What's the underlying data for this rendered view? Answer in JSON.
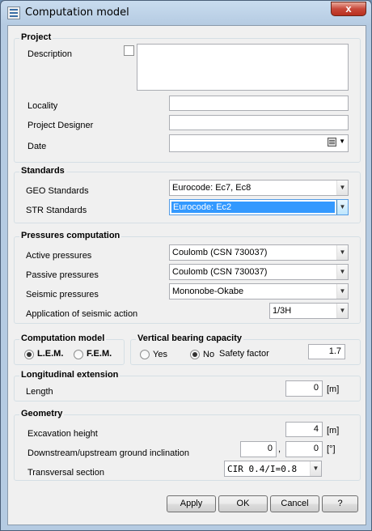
{
  "window": {
    "title": "Computation model",
    "close_glyph": "x"
  },
  "project": {
    "title": "Project",
    "description_label": "Description",
    "description_value": "",
    "locality_label": "Locality",
    "locality_value": "",
    "designer_label": "Project Designer",
    "designer_value": "",
    "date_label": "Date",
    "date_value": ""
  },
  "standards": {
    "title": "Standards",
    "geo_label": "GEO Standards",
    "geo_value": "Eurocode: Ec7, Ec8",
    "str_label": "STR Standards",
    "str_value": "Eurocode: Ec2"
  },
  "pressures": {
    "title": "Pressures computation",
    "active_label": "Active pressures",
    "active_value": "Coulomb (CSN 730037)",
    "passive_label": "Passive pressures",
    "passive_value": "Coulomb (CSN 730037)",
    "seismic_label": "Seismic pressures",
    "seismic_value": "Mononobe-Okabe",
    "application_label": "Application of seismic action",
    "application_value": "1/3H"
  },
  "computation_model": {
    "title": "Computation model",
    "lem_label": "L.E.M.",
    "fem_label": "F.E.M.",
    "selected": "L.E.M."
  },
  "vertical_bearing": {
    "title": "Vertical bearing capacity",
    "yes_label": "Yes",
    "no_label": "No",
    "selected": "No",
    "safety_factor_label": "Safety factor",
    "safety_factor_value": "1.7"
  },
  "longitudinal": {
    "title": "Longitudinal extension",
    "length_label": "Length",
    "length_value": "0",
    "length_unit": "[m]"
  },
  "geometry": {
    "title": "Geometry",
    "excavation_label": "Excavation height",
    "excavation_value": "4",
    "excavation_unit": "[m]",
    "inclination_label": "Downstream/upstream ground inclination",
    "inclination_down": "0",
    "inclination_sep": ",",
    "inclination_up": "0",
    "inclination_unit": "[°]",
    "transversal_label": "Transversal section",
    "transversal_value": "CIR 0.4/I=0.8"
  },
  "buttons": {
    "apply": "Apply",
    "ok": "OK",
    "cancel": "Cancel",
    "help": "?"
  },
  "icons": {
    "calendar": "calendar-icon",
    "dropdown": "chevron-down-icon"
  }
}
